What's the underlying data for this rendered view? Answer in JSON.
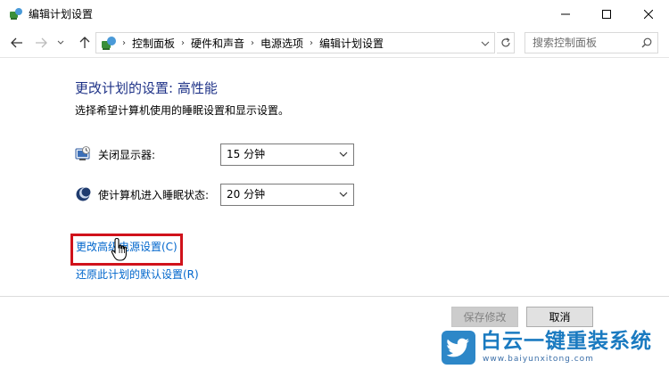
{
  "window": {
    "title": "编辑计划设置",
    "icon": "power-options-icon"
  },
  "nav": {
    "breadcrumbs": [
      "控制面板",
      "硬件和声音",
      "电源选项",
      "编辑计划设置"
    ],
    "search_placeholder": "搜索控制面板"
  },
  "main": {
    "heading": "更改计划的设置: 高性能",
    "subtext": "选择希望计算机使用的睡眠设置和显示设置。",
    "settings": [
      {
        "label": "关闭显示器:",
        "value": "15 分钟",
        "icon": "monitor-icon"
      },
      {
        "label": "使计算机进入睡眠状态:",
        "value": "20 分钟",
        "icon": "sleep-moon-icon"
      }
    ],
    "links": {
      "advanced": "更改高级电源设置(C)",
      "restore": "还原此计划的默认设置(R)"
    }
  },
  "buttons": {
    "save": "保存修改",
    "cancel": "取消"
  },
  "watermark": {
    "title": "白云一键重装系统",
    "url": "www.baiyunxitong.com"
  },
  "colors": {
    "heading": "#1e3287",
    "link": "#0066cc",
    "highlight": "#d0121b",
    "watermark": "#1a7ac0"
  }
}
